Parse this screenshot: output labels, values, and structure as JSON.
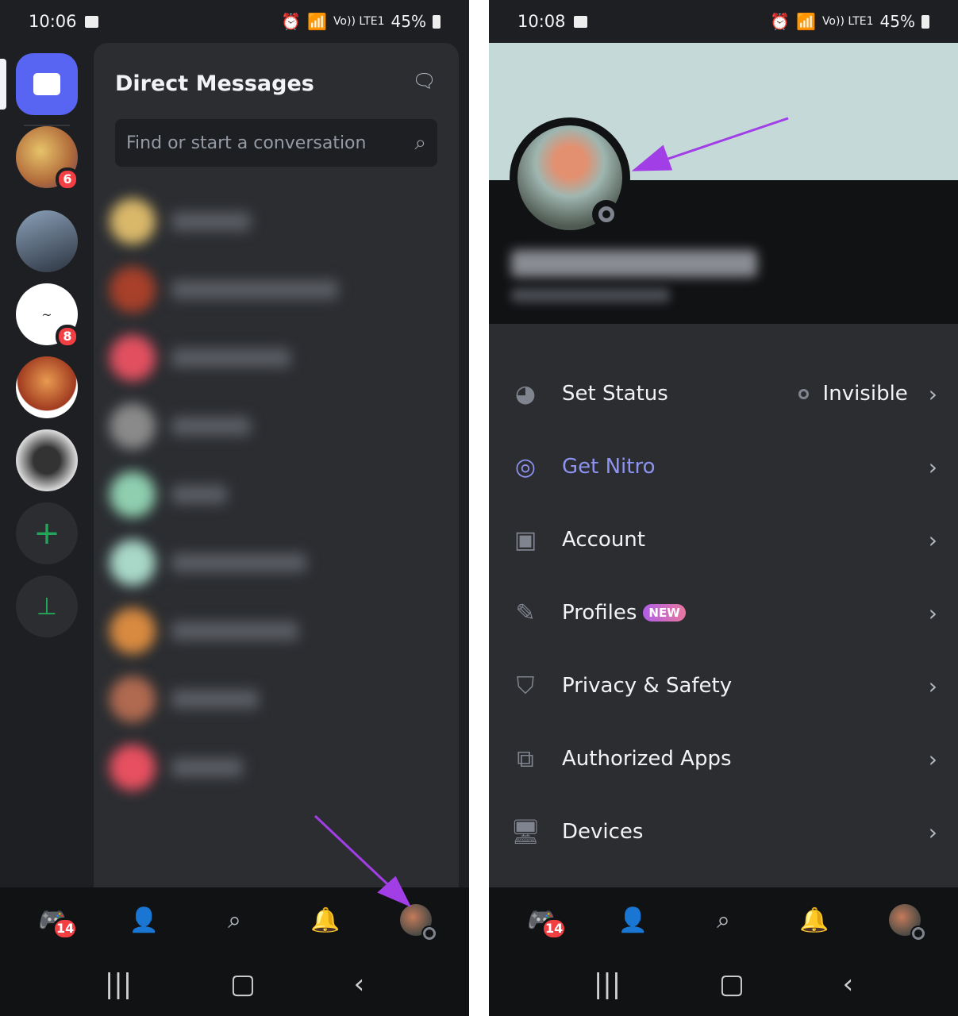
{
  "left": {
    "status": {
      "time": "10:06",
      "indicators": "Vo)) LTE1",
      "battery": "45%"
    },
    "servers": [
      {
        "badge": ""
      },
      {
        "badge": "6"
      },
      {
        "badge": ""
      },
      {
        "badge": "8"
      },
      {
        "badge": ""
      },
      {
        "badge": ""
      }
    ],
    "dm": {
      "title": "Direct Messages",
      "search_placeholder": "Find or start a conversation"
    },
    "nav": {
      "home_badge": "14"
    }
  },
  "right": {
    "status": {
      "time": "10:08",
      "indicators": "Vo)) LTE1",
      "battery": "45%"
    },
    "menu": [
      {
        "label": "Set Status",
        "value": "Invisible",
        "icon": "set-status-icon"
      },
      {
        "label": "Get Nitro",
        "icon": "nitro-icon",
        "color": "#8d93f0"
      },
      {
        "label": "Account",
        "icon": "account-icon"
      },
      {
        "label": "Profiles",
        "badge": "NEW",
        "icon": "pencil-icon"
      },
      {
        "label": "Privacy & Safety",
        "icon": "shield-icon"
      },
      {
        "label": "Authorized Apps",
        "icon": "authorized-apps-icon"
      },
      {
        "label": "Devices",
        "icon": "monitor-icon"
      }
    ],
    "nav": {
      "home_badge": "14"
    }
  },
  "colors": {
    "accent": "#5865f2",
    "annotation_arrow": "#a13ee6",
    "badge": "#f23f43",
    "nitro": "#8d93f0",
    "banner": "#c5d9d9"
  }
}
